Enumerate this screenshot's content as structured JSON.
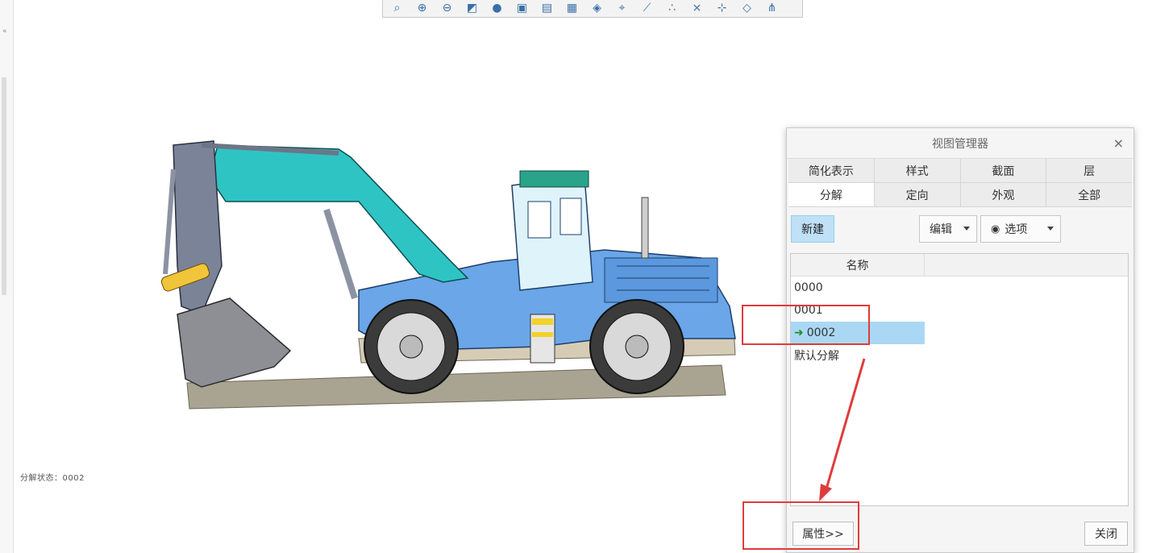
{
  "toolbar": {
    "icons": [
      "refit-icon",
      "zoom-in-icon",
      "zoom-out-icon",
      "repaint-icon",
      "shading-icon",
      "view-cube-icon",
      "saved-views-icon",
      "display-style-icon",
      "appearance-icon",
      "datum-plane-icon",
      "datum-axis-icon",
      "datum-point-icon",
      "csys-icon",
      "annotation-icon",
      "spin-center-icon",
      "datum-display-icon"
    ]
  },
  "viewport": {
    "status_text": "分解状态：0002"
  },
  "dialog": {
    "title": "视图管理器",
    "close_glyph": "×",
    "tabs_row1": [
      "简化表示",
      "样式",
      "截面",
      "层"
    ],
    "tabs_row2": [
      "分解",
      "定向",
      "外观",
      "全部"
    ],
    "active_tab": "分解",
    "new_label": "新建",
    "edit_label": "编辑",
    "options_label": "选项",
    "column_header": "名称",
    "items": [
      {
        "label": "0000",
        "selected": false
      },
      {
        "label": "0001",
        "selected": false
      },
      {
        "label": "0002",
        "selected": true
      },
      {
        "label": "默认分解",
        "selected": false
      }
    ],
    "properties_label": "属性>>",
    "close_label": "关闭"
  },
  "colors": {
    "accent_red": "#e03b3b",
    "selection_blue": "#aad8f4",
    "new_button_blue": "#bfe0f7"
  }
}
